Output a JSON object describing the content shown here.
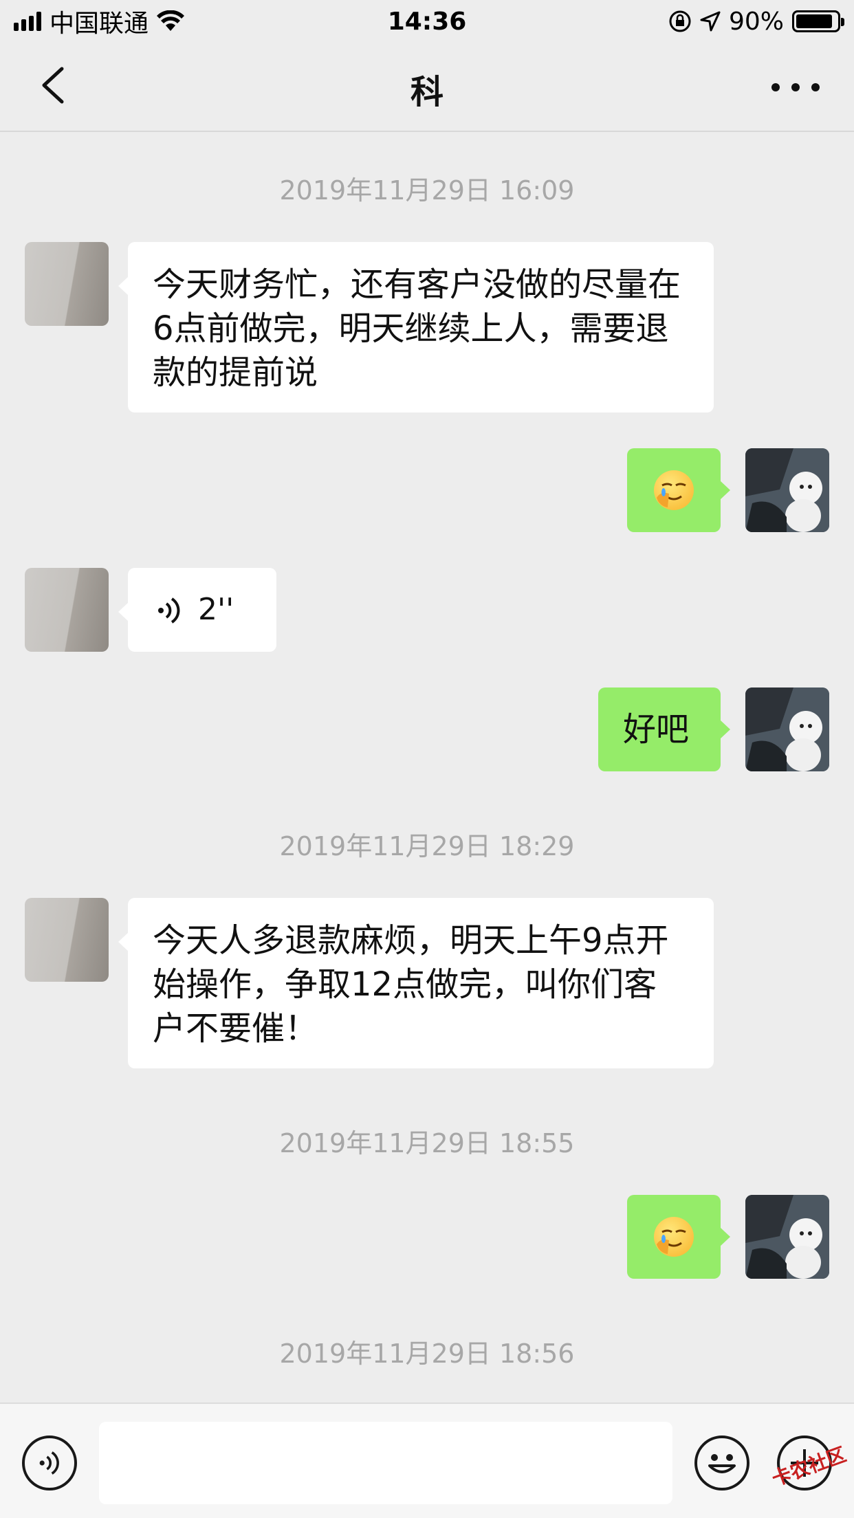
{
  "status_bar": {
    "carrier": "中国联通",
    "time": "14:36",
    "battery_pct": "90%",
    "battery_level": 0.9
  },
  "nav": {
    "title": "科"
  },
  "messages": {
    "ts1": "2019年11月29日 16:09",
    "m1_text": "今天财务忙，还有客户没做的尽量在6点前做完，明天继续上人，需要退款的提前说",
    "m3_voice_duration": "2''",
    "m4_text": "好吧",
    "ts2": "2019年11月29日 18:29",
    "m5_text": "今天人多退款麻烦，明天上午9点开始操作，争取12点做完，叫你们客户不要催！",
    "ts3": "2019年11月29日 18:55",
    "ts4": "2019年11月29日 18:56"
  },
  "watermark": "卡农社区",
  "colors": {
    "background": "#ededed",
    "bubble_self": "#95ec69",
    "bubble_other": "#ffffff",
    "timestamp": "#a7a7a7"
  },
  "icons": [
    "back-chevron-icon",
    "more-dots-icon",
    "voice-icon",
    "emoji-icon",
    "plus-icon",
    "wifi-icon",
    "signal-icon",
    "battery-icon",
    "location-icon",
    "rotation-lock-icon",
    "facepalm-emoji"
  ]
}
